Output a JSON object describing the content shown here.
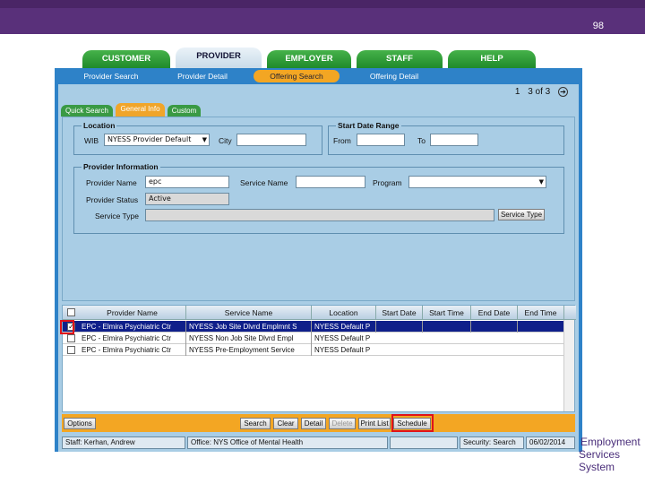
{
  "slide": {
    "page_number": "98"
  },
  "main_tabs": [
    "CUSTOMER",
    "PROVIDER",
    "EMPLOYER",
    "STAFF",
    "HELP"
  ],
  "sub_nav": [
    "Provider Search",
    "Provider Detail",
    "Offering Search",
    "Offering Detail"
  ],
  "pager": {
    "range": "1",
    "of": "3 of 3",
    "next_icon": "next-arrow-icon"
  },
  "sub_tabs": [
    "Quick Search",
    "General Info",
    "Custom"
  ],
  "location": {
    "legend": "Location",
    "wib_label": "WIB",
    "wib_value": "NYESS Provider Default",
    "city_label": "City",
    "city_value": ""
  },
  "start_date_range": {
    "legend": "Start Date Range",
    "from_label": "From",
    "from_value": "",
    "to_label": "To",
    "to_value": ""
  },
  "provider_information": {
    "legend": "Provider Information",
    "provider_name_label": "Provider Name",
    "provider_name_value": "epc",
    "service_name_label": "Service Name",
    "service_name_value": "",
    "program_label": "Program",
    "program_value": "",
    "provider_status_label": "Provider Status",
    "provider_status_value": "Active",
    "service_type_label": "Service Type",
    "service_type_value": "",
    "service_type_button": "Service Type"
  },
  "results": {
    "columns": [
      "Provider Name",
      "Service Name",
      "Location",
      "Start Date",
      "Start Time",
      "End Date",
      "End Time"
    ],
    "rows": [
      {
        "checked": true,
        "selected": true,
        "provider": "EPC - Elmira Psychiatric Ctr",
        "service": "NYESS Job Site Dlvrd Emplmnt S",
        "location": "NYESS Default P",
        "start_date": "",
        "start_time": "",
        "end_date": "",
        "end_time": ""
      },
      {
        "checked": false,
        "selected": false,
        "provider": "EPC - Elmira Psychiatric Ctr",
        "service": "NYESS Non Job Site Dlvrd Empl",
        "location": "NYESS Default P",
        "start_date": "",
        "start_time": "",
        "end_date": "",
        "end_time": ""
      },
      {
        "checked": false,
        "selected": false,
        "provider": "EPC - Elmira Psychiatric Ctr",
        "service": "NYESS Pre-Employment Service",
        "location": "NYESS Default P",
        "start_date": "",
        "start_time": "",
        "end_date": "",
        "end_time": ""
      }
    ]
  },
  "actions": {
    "options": "Options",
    "search": "Search",
    "clear": "Clear",
    "detail": "Detail",
    "delete": "Delete",
    "print_list": "Print List",
    "schedule": "Schedule"
  },
  "status": {
    "staff": "Staff: Kerhan, Andrew",
    "office": "Office: NYS Office of Mental Health",
    "screen": "Security: Search",
    "date": "06/02/2014"
  },
  "logo": {
    "line1": "Employment",
    "line2": "Services System"
  },
  "colors": {
    "header_purple": "#59307a",
    "tab_green": "#2f9a38",
    "app_blue": "#2e82c8",
    "panel_blue": "#a9cde5",
    "accent_orange": "#f3a623",
    "highlight_red": "#e0121a",
    "selected_row": "#0f1f8a"
  }
}
